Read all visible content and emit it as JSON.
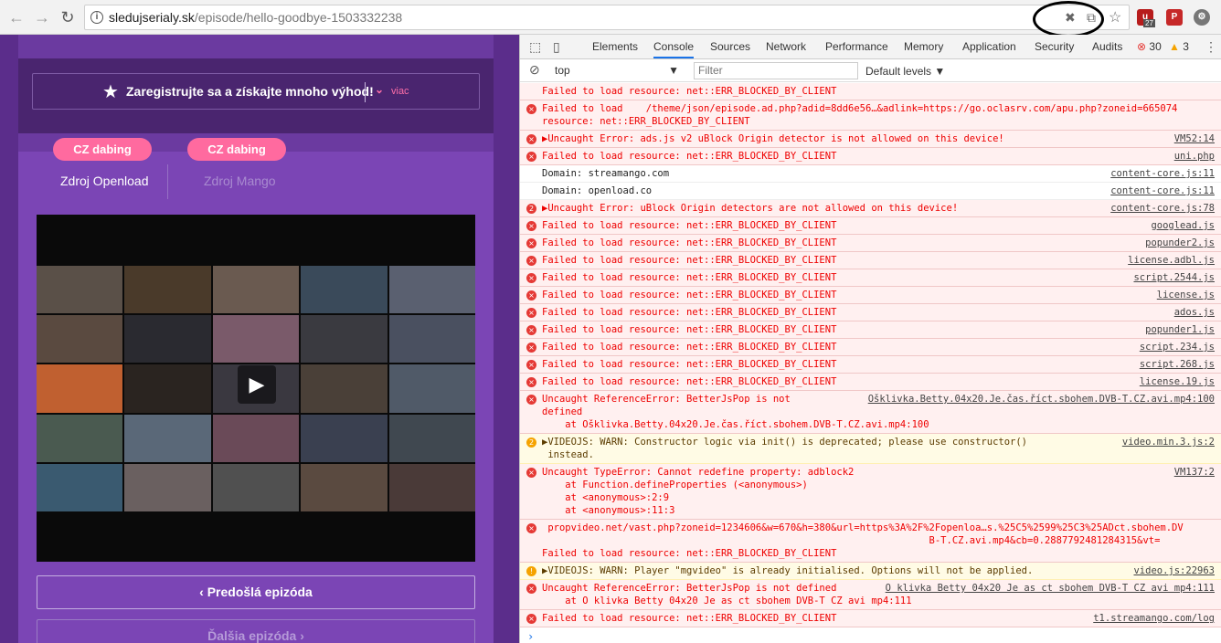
{
  "browser": {
    "url_host": "sledujserialy.sk",
    "url_path": "/episode/hello-goodbye-1503332238",
    "ext_badge_count": "27"
  },
  "site": {
    "promo_text": "Zaregistrujte sa a získajte mnoho výhod!",
    "promo_more": "viac",
    "pill_1": "CZ dabing",
    "pill_2": "CZ dabing",
    "source_1": "Zdroj Openload",
    "source_2": "Zdroj Mango",
    "prev_episode": "Predošlá epizóda",
    "next_episode": "Ďalšia epizóda"
  },
  "devtools": {
    "tabs": [
      "Elements",
      "Console",
      "Sources",
      "Network",
      "Performance",
      "Memory",
      "Application",
      "Security",
      "Audits"
    ],
    "error_count": "30",
    "warn_count": "3",
    "context": "top",
    "filter_placeholder": "Filter",
    "levels": "Default levels"
  },
  "console": [
    {
      "type": "error",
      "icon": "",
      "msg": "Failed to load resource: net::ERR_BLOCKED_BY_CLIENT",
      "src": ""
    },
    {
      "type": "error",
      "icon": "x",
      "msg": "Failed to load    /theme/json/episode.ad.php?adid=8dd6e56…&adlink=https://go.oclasrv.com/apu.php?zoneid=665074\nresource: net::ERR_BLOCKED_BY_CLIENT",
      "src": ""
    },
    {
      "type": "error",
      "icon": "x",
      "msg": "▶Uncaught Error: ads.js v2 uBlock Origin detector is not allowed on this device!",
      "src": "VM52:14"
    },
    {
      "type": "error",
      "icon": "x",
      "msg": "Failed to load resource: net::ERR_BLOCKED_BY_CLIENT",
      "src": "uni.php"
    },
    {
      "type": "info",
      "icon": "",
      "msg": "Domain: streamango.com",
      "src": "content-core.js:11"
    },
    {
      "type": "info",
      "icon": "",
      "msg": "Domain: openload.co",
      "src": "content-core.js:11"
    },
    {
      "type": "error",
      "icon": "2",
      "msg": "▶Uncaught Error: uBlock Origin detectors are not allowed on this device!",
      "src": "content-core.js:78"
    },
    {
      "type": "error",
      "icon": "x",
      "msg": "Failed to load resource: net::ERR_BLOCKED_BY_CLIENT",
      "src": "googlead.js"
    },
    {
      "type": "error",
      "icon": "x",
      "msg": "Failed to load resource: net::ERR_BLOCKED_BY_CLIENT",
      "src": "popunder2.js"
    },
    {
      "type": "error",
      "icon": "x",
      "msg": "Failed to load resource: net::ERR_BLOCKED_BY_CLIENT",
      "src": "license.adbl.js"
    },
    {
      "type": "error",
      "icon": "x",
      "msg": "Failed to load resource: net::ERR_BLOCKED_BY_CLIENT",
      "src": "script.2544.js"
    },
    {
      "type": "error",
      "icon": "x",
      "msg": "Failed to load resource: net::ERR_BLOCKED_BY_CLIENT",
      "src": "license.js"
    },
    {
      "type": "error",
      "icon": "x",
      "msg": "Failed to load resource: net::ERR_BLOCKED_BY_CLIENT",
      "src": "ados.js"
    },
    {
      "type": "error",
      "icon": "x",
      "msg": "Failed to load resource: net::ERR_BLOCKED_BY_CLIENT",
      "src": "popunder1.js"
    },
    {
      "type": "error",
      "icon": "x",
      "msg": "Failed to load resource: net::ERR_BLOCKED_BY_CLIENT",
      "src": "script.234.js"
    },
    {
      "type": "error",
      "icon": "x",
      "msg": "Failed to load resource: net::ERR_BLOCKED_BY_CLIENT",
      "src": "script.268.js"
    },
    {
      "type": "error",
      "icon": "x",
      "msg": "Failed to load resource: net::ERR_BLOCKED_BY_CLIENT",
      "src": "license.19.js"
    },
    {
      "type": "error",
      "icon": "x",
      "msg": "Uncaught ReferenceError: BetterJsPop is not\ndefined\n    at Ošklivka.Betty.04x20.Je.čas.říct.sbohem.DVB-T.CZ.avi.mp4:100",
      "src": "Ošklivka.Betty.04x20.Je.čas.říct.sbohem.DVB-T.CZ.avi.mp4:100"
    },
    {
      "type": "warn",
      "icon": "2",
      "msg": "▶VIDEOJS: WARN: Constructor logic via init() is deprecated; please use constructor()\n instead.",
      "src": "video.min.3.js:2"
    },
    {
      "type": "error",
      "icon": "x",
      "msg": "Uncaught TypeError: Cannot redefine property: adblock2\n    at Function.defineProperties (<anonymous>)\n    at <anonymous>:2:9\n    at <anonymous>:11:3",
      "src": "VM137:2"
    },
    {
      "type": "error",
      "icon": "x",
      "msg": " propvideo.net/vast.php?zoneid=1234606&w=670&h=380&url=https%3A%2F%2Fopenloa…s.%25C5%2599%25C3%25ADct.sbohem.DV\n                                                                   B-T.CZ.avi.mp4&cb=0.2887792481284315&vt=\nFailed to load resource: net::ERR_BLOCKED_BY_CLIENT",
      "src": ""
    },
    {
      "type": "warn",
      "icon": "!",
      "msg": "▶VIDEOJS: WARN: Player \"mgvideo\" is already initialised. Options will not be applied.",
      "src": "video.js:22963"
    },
    {
      "type": "error",
      "icon": "x",
      "msg": "Uncaught ReferenceError: BetterJsPop is not defined\n    at O klivka Betty 04x20 Je as ct sbohem DVB-T CZ avi mp4:111",
      "src": "O klivka Betty 04x20 Je as ct sbohem DVB-T CZ avi mp4:111"
    },
    {
      "type": "error",
      "icon": "x",
      "msg": "Failed to load resource: net::ERR_BLOCKED_BY_CLIENT",
      "src": "t1.streamango.com/log"
    }
  ]
}
